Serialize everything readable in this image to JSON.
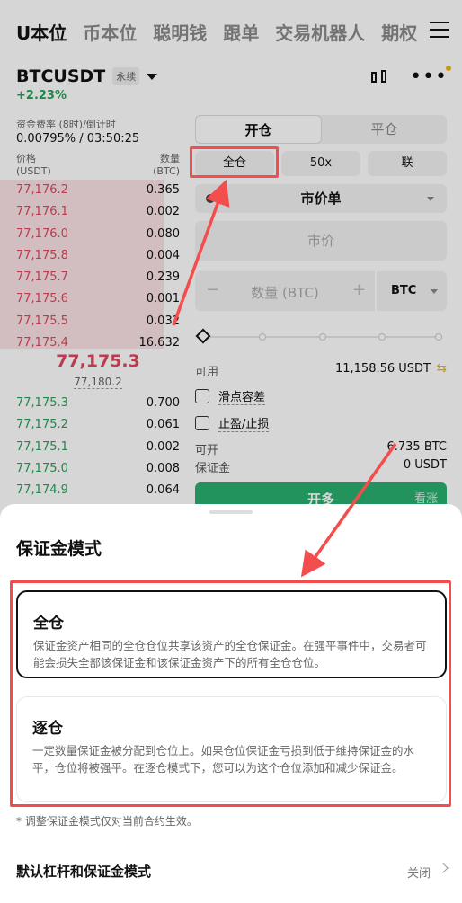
{
  "nav": {
    "tabs": [
      "U本位",
      "币本位",
      "聪明钱",
      "跟单",
      "交易机器人",
      "期权"
    ]
  },
  "header": {
    "symbol": "BTCUSDT",
    "contract_tag": "永续",
    "change": "+2.23%",
    "icons": [
      "candlestick-icon",
      "more-icon"
    ]
  },
  "funding": {
    "label": "资金费率 (8时)/倒计时",
    "value": "0.00795% / 03:50:25"
  },
  "orderbook": {
    "price_header": "价格",
    "price_unit": "(USDT)",
    "qty_header": "数量",
    "qty_unit": "(BTC)",
    "asks": [
      {
        "price": "77,176.2",
        "qty": "0.365"
      },
      {
        "price": "77,176.1",
        "qty": "0.002"
      },
      {
        "price": "77,176.0",
        "qty": "0.080"
      },
      {
        "price": "77,175.8",
        "qty": "0.004"
      },
      {
        "price": "77,175.7",
        "qty": "0.239"
      },
      {
        "price": "77,175.6",
        "qty": "0.001"
      },
      {
        "price": "77,175.5",
        "qty": "0.032"
      },
      {
        "price": "77,175.4",
        "qty": "16.632"
      }
    ],
    "last_price": "77,175.3",
    "mark_price": "77,180.2",
    "bids": [
      {
        "price": "77,175.3",
        "qty": "0.700"
      },
      {
        "price": "77,175.2",
        "qty": "0.061"
      },
      {
        "price": "77,175.1",
        "qty": "0.002"
      },
      {
        "price": "77,175.0",
        "qty": "0.008"
      },
      {
        "price": "77,174.9",
        "qty": "0.064"
      }
    ]
  },
  "form": {
    "open_label": "开仓",
    "close_label": "平仓",
    "margin_mode": "全仓",
    "leverage": "50x",
    "position_mode": "联",
    "order_type": "市价单",
    "price_placeholder": "市价",
    "qty_placeholder": "数量 (BTC)",
    "qty_unit": "BTC",
    "available_label": "可用",
    "available_value": "11,158.56 USDT",
    "slippage_label": "滑点容差",
    "tpsl_label": "止盈/止损",
    "can_open_label": "可开",
    "can_open_value": "6.735 BTC",
    "margin_label": "保证金",
    "margin_value": "0 USDT",
    "buy_label": "开多",
    "buy_side": "看涨"
  },
  "sheet": {
    "title": "保证金模式",
    "options": [
      {
        "title": "全仓",
        "desc": "保证金资产相同的全仓仓位共享该资产的全仓保证金。在强平事件中，交易者可能会损失全部该保证金和该保证金资产下的所有全仓仓位。",
        "selected": true
      },
      {
        "title": "逐仓",
        "desc": "一定数量保证金被分配到仓位上。如果仓位保证金亏损到低于维持保证金的水平，仓位将被强平。在逐仓模式下，您可以为这个仓位添加和减少保证金。",
        "selected": false
      }
    ],
    "note": "* 调整保证金模式仅对当前合约生效。",
    "default_label": "默认杠杆和保证金模式",
    "default_value": "关闭"
  },
  "colors": {
    "ask": "#e0475e",
    "bid": "#27a35a",
    "annotation": "#f44d4d"
  }
}
